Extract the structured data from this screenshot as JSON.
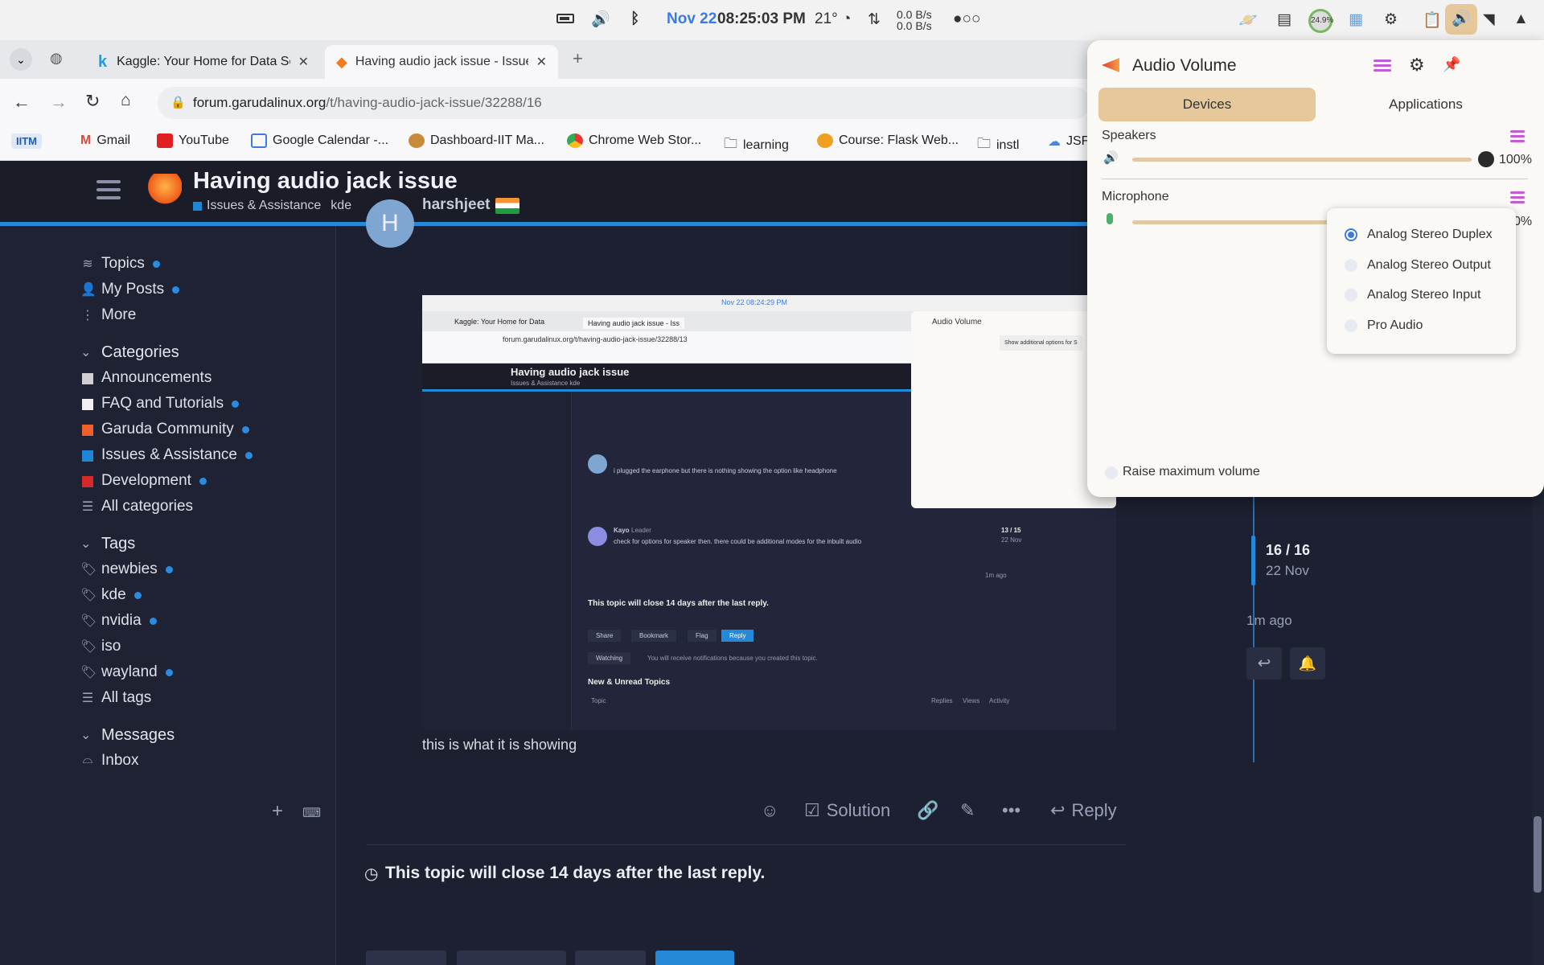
{
  "system_bar": {
    "date": "Nov 22",
    "time": "08:25:03 PM",
    "temperature": "21°",
    "net_up": "0.0 B/s",
    "net_down": "0.0 B/s",
    "cpu_label": "24.9%"
  },
  "browser": {
    "tabs": [
      {
        "title": "Kaggle: Your Home for Data Science",
        "active": false
      },
      {
        "title": "Having audio jack issue - Issues & Assistance",
        "active": true
      }
    ],
    "url_host": "forum.garudalinux.org",
    "url_path": "/t/having-audio-jack-issue/32288/16",
    "bookmarks": [
      "IITM",
      "Gmail",
      "YouTube",
      "Google Calendar -...",
      "Dashboard-IIT Ma...",
      "Chrome Web Stor...",
      "learning",
      "Course: Flask Web...",
      "instl",
      "JSF"
    ]
  },
  "forum": {
    "title": "Having audio jack issue",
    "category": "Issues & Assistance",
    "tag": "kde",
    "sidebar": {
      "top": [
        {
          "label": "Topics",
          "dot": true
        },
        {
          "label": "My Posts",
          "dot": true
        },
        {
          "label": "More",
          "dot": false
        }
      ],
      "categories_header": "Categories",
      "categories": [
        {
          "label": "Announcements",
          "color": "#d0d0d0",
          "dot": false
        },
        {
          "label": "FAQ and Tutorials",
          "color": "#f0f0f0",
          "dot": true
        },
        {
          "label": "Garuda Community",
          "color": "#f0602a",
          "dot": true
        },
        {
          "label": "Issues & Assistance",
          "color": "#1f86d6",
          "dot": true
        },
        {
          "label": "Development",
          "color": "#d62a2a",
          "dot": true
        },
        {
          "label": "All categories",
          "color": "",
          "dot": false
        }
      ],
      "tags_header": "Tags",
      "tags": [
        {
          "label": "newbies",
          "dot": true
        },
        {
          "label": "kde",
          "dot": true
        },
        {
          "label": "nvidia",
          "dot": true
        },
        {
          "label": "iso",
          "dot": false
        },
        {
          "label": "wayland",
          "dot": true
        },
        {
          "label": "All tags",
          "dot": false
        }
      ],
      "messages_header": "Messages",
      "messages": [
        {
          "label": "Inbox"
        }
      ]
    },
    "post": {
      "avatar_letter": "H",
      "author": "harshjeet",
      "body": "this is what it is showing",
      "actions": {
        "solution": "Solution",
        "reply": "Reply"
      }
    },
    "close_notice": "This topic will close 14 days after the last reply.",
    "timeline": {
      "position": "16 / 16",
      "date": "22 Nov",
      "ago": "1m ago"
    },
    "embedded_screenshot": {
      "time": "Nov 22 08:24:29 PM",
      "tab1": "Kaggle: Your Home for Data",
      "tab2": "Having audio jack issue - Iss",
      "url": "forum.garudalinux.org/t/having-audio-jack-issue/32288/13",
      "title": "Having audio jack issue",
      "subtitle": "Issues & Assistance  kde",
      "post1_text": "i plugged the earphone but there is nothing showing the option like headphone",
      "post2_author": "Kayo",
      "post2_role": "Leader",
      "post2_text": "check for options for speaker then. there could be additional modes for the inbuilt audio",
      "close_text": "This topic will close 14 days after the last reply.",
      "buttons": [
        "Share",
        "Bookmark",
        "Flag",
        "Reply"
      ],
      "watching": "Watching",
      "watching_text": "You will receive notifications because you created this topic.",
      "new_unread": "New & Unread Topics",
      "table_cols": [
        "Topic",
        "Replies",
        "Views",
        "Activity"
      ],
      "timeline_pos": "13 / 15",
      "timeline_date": "22 Nov",
      "timeline_ago": "1m ago",
      "popup_title": "Audio Volume",
      "popup_tooltip": "Show additional options for S"
    }
  },
  "audio_popup": {
    "title": "Audio Volume",
    "tabs": [
      "Devices",
      "Applications"
    ],
    "speakers_label": "Speakers",
    "speakers_level": 1.0,
    "speakers_percent": "100%",
    "microphone_label": "Microphone",
    "microphone_percent": "0%",
    "profiles": [
      "Analog Stereo Duplex",
      "Analog Stereo Output",
      "Analog Stereo Input",
      "Pro Audio"
    ],
    "selected_profile": "Analog Stereo Duplex",
    "raise_max": "Raise maximum volume"
  }
}
